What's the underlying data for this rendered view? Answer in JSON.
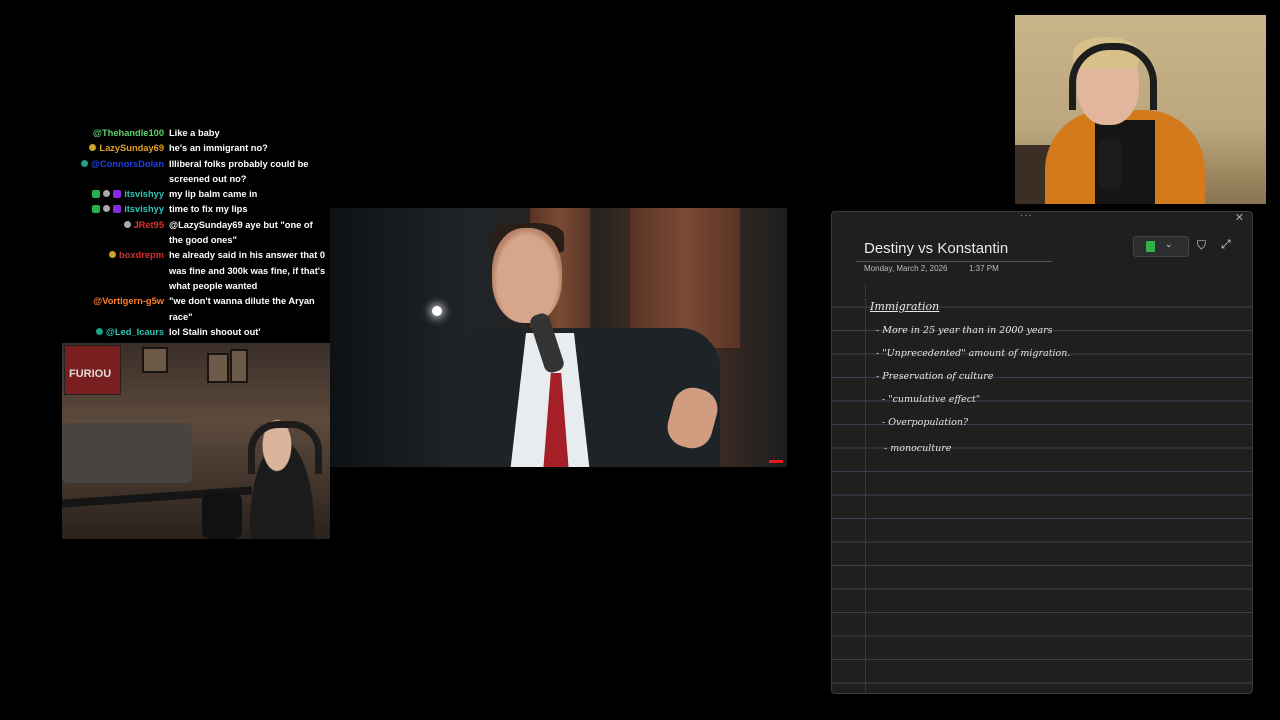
{
  "chat": {
    "messages": [
      {
        "user": "@Thehandle100",
        "color": "#5fd36b",
        "badges": [],
        "text": "Like a baby"
      },
      {
        "user": "LazySunday69",
        "color": "#e0a020",
        "badges": [
          "gold"
        ],
        "text": "he's an immigrant no?"
      },
      {
        "user": "@ConnorsDolan",
        "color": "#1e40e0",
        "badges": [
          "teal"
        ],
        "text": "Illiberal folks probably could be screened out no?"
      },
      {
        "user": "itsvishyy",
        "color": "#2ec4b6",
        "badges": [
          "green",
          "skull",
          "purple"
        ],
        "text": "my lip balm came in"
      },
      {
        "user": "itsvishyy",
        "color": "#2ec4b6",
        "badges": [
          "green",
          "skull",
          "purple"
        ],
        "text": "time to fix my lips"
      },
      {
        "user": "JRet95",
        "color": "#e03030",
        "badges": [
          "skull"
        ],
        "text": "@LazySunday69 aye but \"one of the good ones\""
      },
      {
        "user": "boxdrepm",
        "color": "#d32f2f",
        "badges": [
          "gold"
        ],
        "text": "he already said in his answer that 0 was fine and 300k was fine, if that's what people wanted"
      },
      {
        "user": "@Vortigern-g5w",
        "color": "#ff7f2a",
        "badges": [],
        "text": "\"we don't wanna dilute the Aryan race\""
      },
      {
        "user": "@Led_Icaurs",
        "color": "#2ec4b6",
        "badges": [
          "teal"
        ],
        "text": "lol Stalin shoout out'"
      }
    ]
  },
  "webcam_left": {
    "poster_text": "FURIOU"
  },
  "note": {
    "title": "Destiny vs Konstantin",
    "date": "Monday, March 2, 2026",
    "time": "1:37 PM",
    "toolbar_notebook_color": "#2fb34a",
    "heading": "Immigration",
    "lines": [
      "- More in 25 year than in 2000 years",
      "- \"Unprecedented\" amount of migration.",
      "- Preservation of culture",
      "- \"cumulative effect\"",
      "- Overpopulation?",
      "- monoculture"
    ]
  }
}
